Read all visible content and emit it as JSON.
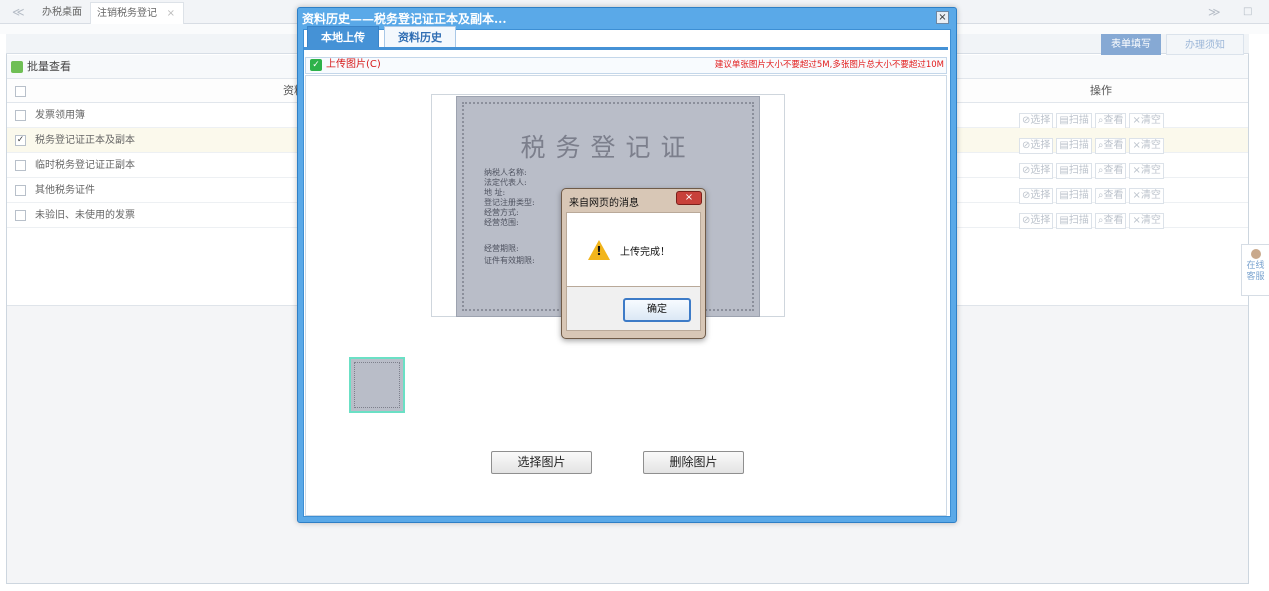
{
  "topbar": {
    "nav_left": "≪",
    "nav_right": "≫",
    "minimize": "□",
    "tabs": [
      {
        "label": "办税桌面"
      },
      {
        "label": "注销税务登记",
        "close": "×"
      }
    ]
  },
  "right_tabs": {
    "fill_form": "表单填写",
    "guide": "办理须知"
  },
  "batch": {
    "label": "批量查看"
  },
  "table": {
    "headers": {
      "item": "资料",
      "ops": "操作"
    },
    "row_ops": [
      "选择",
      "扫描",
      "查看",
      "清空"
    ],
    "rows": [
      {
        "label": "发票领用簿",
        "checked": false
      },
      {
        "label": "税务登记证正本及副本",
        "checked": true
      },
      {
        "label": "临时税务登记证正副本",
        "checked": false
      },
      {
        "label": "其他税务证件",
        "checked": false
      },
      {
        "label": "未验旧、未使用的发票",
        "checked": false
      }
    ]
  },
  "side_widget": {
    "line1": "在线",
    "line2": "客服"
  },
  "dialog": {
    "title": "资料历史——税务登记证正本及副本...",
    "close": "×",
    "tabs": {
      "local_upload": "本地上传",
      "history": "资料历史"
    },
    "upload_label": "上传图片(C)",
    "upload_hint": "建议单张图片大小不要超过5M,多张图片总大小不要超过10M",
    "buttons": {
      "select": "选择图片",
      "delete": "删除图片"
    },
    "certificate": {
      "title": "税务登记证",
      "field_1": "纳税人名称:",
      "field_2": "法定代表人:",
      "field_3": "地 址:",
      "field_4": "登记注册类型:",
      "field_5": "经营方式:",
      "field_6": "经营范围:",
      "field_7": "经营期限:",
      "field_8": "证件有效期限:"
    }
  },
  "message_box": {
    "title": "来自网页的消息",
    "close": "×",
    "text": "上传完成！",
    "ok": "确定"
  }
}
